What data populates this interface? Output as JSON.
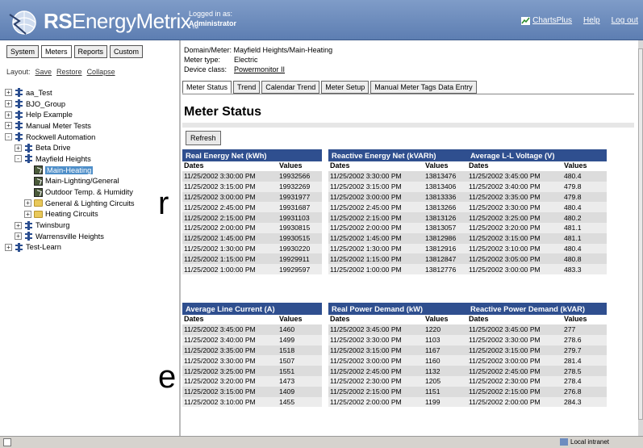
{
  "header": {
    "brand_bold": "RS",
    "brand_rest": "EnergyMetrix",
    "brand_tm": "™",
    "logged_in_label": "Logged in as:",
    "user": "Administrator",
    "links": {
      "charts_plus": "ChartsPlus",
      "help": "Help",
      "logout": "Log out"
    }
  },
  "left": {
    "tabs": [
      "System",
      "Meters",
      "Reports",
      "Custom"
    ],
    "layout_label": "Layout:",
    "layout_links": [
      "Save",
      "Restore",
      "Collapse"
    ],
    "tree": [
      {
        "label": "aa_Test",
        "exp": "+",
        "icon": "meter",
        "indent": 0
      },
      {
        "label": "BJO_Group",
        "exp": "+",
        "icon": "meter",
        "indent": 0
      },
      {
        "label": "Help Example",
        "exp": "+",
        "icon": "meter",
        "indent": 0
      },
      {
        "label": "Manual Meter Tests",
        "exp": "+",
        "icon": "meter",
        "indent": 0
      },
      {
        "label": "Rockwell Automation",
        "exp": "-",
        "icon": "meter",
        "indent": 0
      },
      {
        "label": "Beta Drive",
        "exp": "+",
        "icon": "meter",
        "indent": 1
      },
      {
        "label": "Mayfield Heights",
        "exp": "-",
        "icon": "meter",
        "indent": 1
      },
      {
        "label": "Main-Heating",
        "exp": "",
        "icon": "pt",
        "indent": 2,
        "selected": true
      },
      {
        "label": "Main-Lighting/General",
        "exp": "",
        "icon": "pt",
        "indent": 2
      },
      {
        "label": "Outdoor Temp. & Humidity",
        "exp": "",
        "icon": "pt",
        "indent": 2
      },
      {
        "label": "General & Lighting Circuits",
        "exp": "+",
        "icon": "folder",
        "indent": 2
      },
      {
        "label": "Heating Circuits",
        "exp": "+",
        "icon": "folder",
        "indent": 2
      },
      {
        "label": "Twinsburg",
        "exp": "+",
        "icon": "meter",
        "indent": 1
      },
      {
        "label": "Warrensville Heights",
        "exp": "+",
        "icon": "meter",
        "indent": 1
      },
      {
        "label": "Test-Learn",
        "exp": "+",
        "icon": "meter",
        "indent": 0
      }
    ]
  },
  "bg_chars": [
    "r",
    "e"
  ],
  "main": {
    "domain_meter_label": "Domain/Meter:",
    "domain_meter": "Mayfield Heights/Main-Heating",
    "meter_type_label": "Meter type:",
    "meter_type": "Electric",
    "device_class_label": "Device class:",
    "device_class": "Powermonitor II",
    "tabs": [
      "Meter Status",
      "Trend",
      "Calendar Trend",
      "Meter Setup",
      "Manual Meter Tags Data Entry"
    ],
    "title": "Meter Status",
    "refresh_label": "Refresh",
    "col_dates": "Dates",
    "col_values": "Values",
    "tables": [
      {
        "title": "Real Energy Net (kWh)",
        "rows": [
          [
            "11/25/2002 3:30:00 PM",
            "19932566"
          ],
          [
            "11/25/2002 3:15:00 PM",
            "19932269"
          ],
          [
            "11/25/2002 3:00:00 PM",
            "19931977"
          ],
          [
            "11/25/2002 2:45:00 PM",
            "19931687"
          ],
          [
            "11/25/2002 2:15:00 PM",
            "19931103"
          ],
          [
            "11/25/2002 2:00:00 PM",
            "19930815"
          ],
          [
            "11/25/2002 1:45:00 PM",
            "19930515"
          ],
          [
            "11/25/2002 1:30:00 PM",
            "19930220"
          ],
          [
            "11/25/2002 1:15:00 PM",
            "19929911"
          ],
          [
            "11/25/2002 1:00:00 PM",
            "19929597"
          ]
        ]
      },
      {
        "title": "Reactive Energy Net (kVARh)",
        "rows": [
          [
            "11/25/2002 3:30:00 PM",
            "13813476"
          ],
          [
            "11/25/2002 3:15:00 PM",
            "13813406"
          ],
          [
            "11/25/2002 3:00:00 PM",
            "13813336"
          ],
          [
            "11/25/2002 2:45:00 PM",
            "13813266"
          ],
          [
            "11/25/2002 2:15:00 PM",
            "13813126"
          ],
          [
            "11/25/2002 2:00:00 PM",
            "13813057"
          ],
          [
            "11/25/2002 1:45:00 PM",
            "13812986"
          ],
          [
            "11/25/2002 1:30:00 PM",
            "13812916"
          ],
          [
            "11/25/2002 1:15:00 PM",
            "13812847"
          ],
          [
            "11/25/2002 1:00:00 PM",
            "13812776"
          ]
        ]
      },
      {
        "title": "Average L-L Voltage (V)",
        "rows": [
          [
            "11/25/2002 3:45:00 PM",
            "480.4"
          ],
          [
            "11/25/2002 3:40:00 PM",
            "479.8"
          ],
          [
            "11/25/2002 3:35:00 PM",
            "479.8"
          ],
          [
            "11/25/2002 3:30:00 PM",
            "480.4"
          ],
          [
            "11/25/2002 3:25:00 PM",
            "480.2"
          ],
          [
            "11/25/2002 3:20:00 PM",
            "481.1"
          ],
          [
            "11/25/2002 3:15:00 PM",
            "481.1"
          ],
          [
            "11/25/2002 3:10:00 PM",
            "480.4"
          ],
          [
            "11/25/2002 3:05:00 PM",
            "480.8"
          ],
          [
            "11/25/2002 3:00:00 PM",
            "483.3"
          ]
        ]
      },
      {
        "title": "Average Line Current (A)",
        "rows": [
          [
            "11/25/2002 3:45:00 PM",
            "1460"
          ],
          [
            "11/25/2002 3:40:00 PM",
            "1499"
          ],
          [
            "11/25/2002 3:35:00 PM",
            "1518"
          ],
          [
            "11/25/2002 3:30:00 PM",
            "1507"
          ],
          [
            "11/25/2002 3:25:00 PM",
            "1551"
          ],
          [
            "11/25/2002 3:20:00 PM",
            "1473"
          ],
          [
            "11/25/2002 3:15:00 PM",
            "1409"
          ],
          [
            "11/25/2002 3:10:00 PM",
            "1455"
          ]
        ]
      },
      {
        "title": "Real Power Demand (kW)",
        "rows": [
          [
            "11/25/2002 3:45:00 PM",
            "1220"
          ],
          [
            "11/25/2002 3:30:00 PM",
            "1103"
          ],
          [
            "11/25/2002 3:15:00 PM",
            "1167"
          ],
          [
            "11/25/2002 3:00:00 PM",
            "1160"
          ],
          [
            "11/25/2002 2:45:00 PM",
            "1132"
          ],
          [
            "11/25/2002 2:30:00 PM",
            "1205"
          ],
          [
            "11/25/2002 2:15:00 PM",
            "1151"
          ],
          [
            "11/25/2002 2:00:00 PM",
            "1199"
          ]
        ]
      },
      {
        "title": "Reactive Power Demand (kVAR)",
        "rows": [
          [
            "11/25/2002 3:45:00 PM",
            "277"
          ],
          [
            "11/25/2002 3:30:00 PM",
            "278.6"
          ],
          [
            "11/25/2002 3:15:00 PM",
            "279.7"
          ],
          [
            "11/25/2002 3:00:00 PM",
            "281.4"
          ],
          [
            "11/25/2002 2:45:00 PM",
            "278.5"
          ],
          [
            "11/25/2002 2:30:00 PM",
            "278.4"
          ],
          [
            "11/25/2002 2:15:00 PM",
            "276.8"
          ],
          [
            "11/25/2002 2:00:00 PM",
            "284.3"
          ]
        ]
      }
    ]
  },
  "statusbar": {
    "zone": "Local intranet"
  }
}
